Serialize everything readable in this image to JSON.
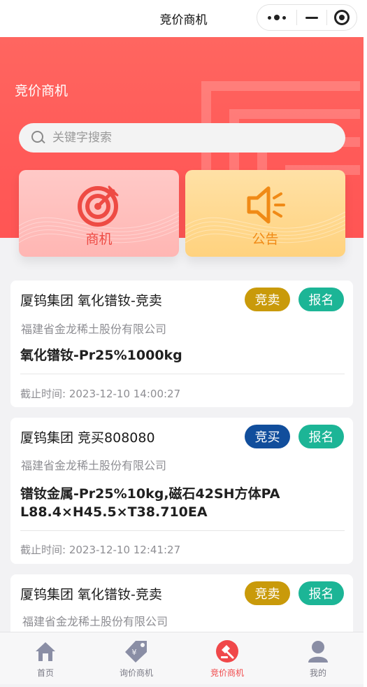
{
  "navbar": {
    "title": "竞价商机"
  },
  "hero": {
    "title": "竞价商机",
    "search_placeholder": "关键字搜索",
    "categories": [
      {
        "label": "商机",
        "icon": "target-arrow-icon"
      },
      {
        "label": "公告",
        "icon": "megaphone-icon"
      }
    ]
  },
  "listings": [
    {
      "title": "厦钨集团 氧化镨钕-竞卖",
      "type_tag": "竞卖",
      "signup_label": "报名",
      "company": "福建省金龙稀土股份有限公司",
      "product": "氧化镨钕-Pr25%1000kg",
      "deadline": "截止时间: 2023-12-10 14:00:27"
    },
    {
      "title": "厦钨集团 竞买808080",
      "type_tag": "竞买",
      "signup_label": "报名",
      "company": "福建省金龙稀土股份有限公司",
      "product": "镨钕金属-Pr25%10kg,磁石42SH方体PA L88.4×H45.5×T38.710EA",
      "deadline": "截止时间: 2023-12-10 12:41:27"
    },
    {
      "title": "厦钨集团 氧化镨钕-竞卖",
      "type_tag": "竞卖",
      "signup_label": "报名",
      "company": "福建省金龙稀土股份有限公司"
    }
  ],
  "colors": {
    "sell_tag": "#c99a0a",
    "buy_tag": "#114e9c",
    "signup_tag": "#1cb596",
    "hero_red": "#ff5a58",
    "active_tab": "#f0484a"
  },
  "tabbar": {
    "items": [
      {
        "label": "首页",
        "icon": "home-icon"
      },
      {
        "label": "询价商机",
        "icon": "price-tag-icon"
      },
      {
        "label": "竞价商机",
        "icon": "auction-icon"
      },
      {
        "label": "我的",
        "icon": "user-icon"
      }
    ],
    "active_index": 2
  }
}
